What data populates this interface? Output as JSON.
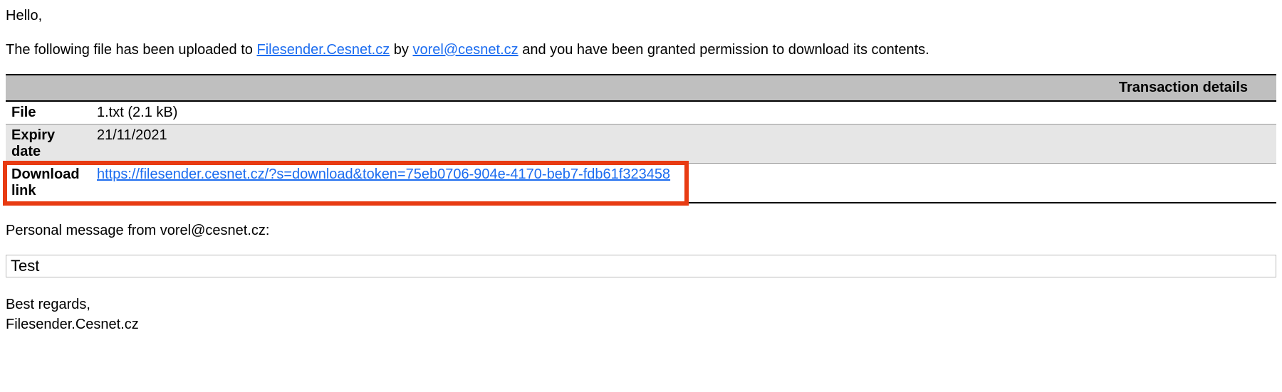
{
  "greeting": "Hello,",
  "intro": {
    "prefix": "The following file has been uploaded to ",
    "service_link": "Filesender.Cesnet.cz",
    "mid": " by ",
    "sender_email": "vorel@cesnet.cz",
    "suffix": " and you have been granted permission to download its contents."
  },
  "table": {
    "header": "Transaction details",
    "rows": {
      "file": {
        "label": "File",
        "value": "1.txt (2.1 kB)"
      },
      "expiry": {
        "label": "Expiry date",
        "value": "21/11/2021"
      },
      "download": {
        "label": "Download link",
        "url": "https://filesender.cesnet.cz/?s=download&token=75eb0706-904e-4170-beb7-fdb61f323458"
      }
    }
  },
  "personal_msg_label": "Personal message from vorel@cesnet.cz:",
  "personal_msg": "Test",
  "signoff_line1": "Best regards,",
  "signoff_line2": "Filesender.Cesnet.cz"
}
